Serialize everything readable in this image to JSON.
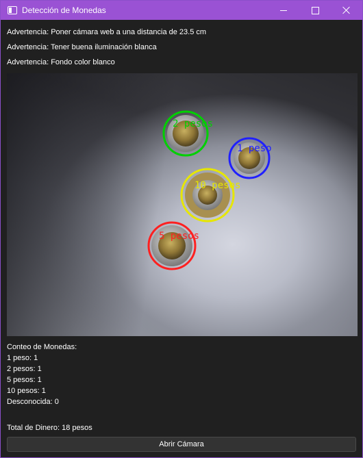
{
  "window": {
    "title": "Detección de Monedas"
  },
  "warnings": [
    "Advertencia: Poner cámara web a una distancia de 23.5 cm",
    "Advertencia: Tener buena iluminación blanca",
    "Advertencia: Fondo color blanco"
  ],
  "camera": {
    "detections": [
      {
        "label": "2 pesos",
        "color": "#00d000"
      },
      {
        "label": "1 peso",
        "color": "#2020ff"
      },
      {
        "label": "10 pesos",
        "color": "#e6e600"
      },
      {
        "label": "5 pesos",
        "color": "#ff2020"
      }
    ]
  },
  "counts": {
    "heading": "Conteo de Monedas:",
    "lines": [
      "1 peso: 1",
      "2 pesos: 1",
      "5 pesos: 1",
      "10 pesos: 1",
      "Desconocida: 0"
    ]
  },
  "total": "Total de Dinero: 18 pesos",
  "button": {
    "label": "Abrir Cámara"
  },
  "colors": {
    "titlebar": "#9a52d4",
    "background": "#202020"
  }
}
